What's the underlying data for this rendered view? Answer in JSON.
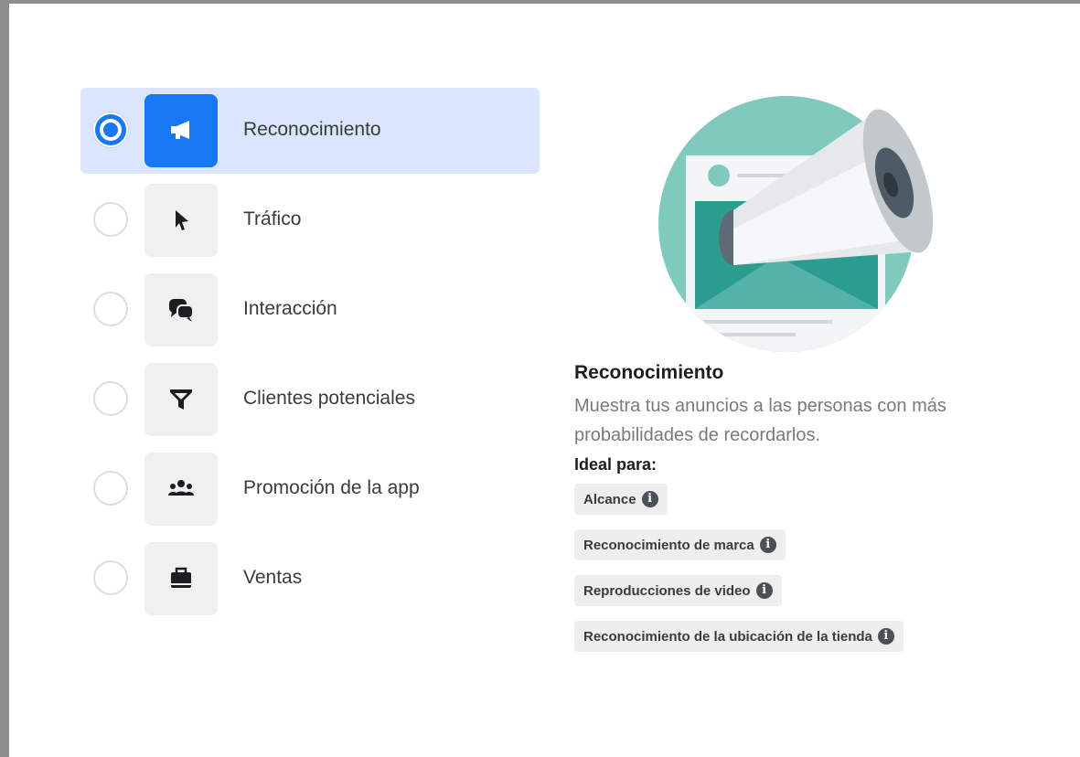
{
  "objectives": [
    {
      "label": "Reconocimiento",
      "icon": "megaphone-icon",
      "selected": true
    },
    {
      "label": "Tráfico",
      "icon": "cursor-icon",
      "selected": false
    },
    {
      "label": "Interacción",
      "icon": "chat-bubbles-icon",
      "selected": false
    },
    {
      "label": "Clientes potenciales",
      "icon": "filter-icon",
      "selected": false
    },
    {
      "label": "Promoción de la app",
      "icon": "people-icon",
      "selected": false
    },
    {
      "label": "Ventas",
      "icon": "shopping-bag-icon",
      "selected": false
    }
  ],
  "detail": {
    "title": "Reconocimiento",
    "description": "Muestra tus anuncios a las personas con más probabilidades de recordarlos.",
    "ideal_label": "Ideal para:",
    "tags": [
      "Alcance",
      "Reconocimiento de marca",
      "Reproducciones de video",
      "Reconocimiento de la ubicación de la tienda"
    ],
    "info_glyph": "i"
  },
  "colors": {
    "accent": "#1877f2",
    "selected_bg": "#d9e6fb",
    "illustration_teal": "#7fc9bd"
  }
}
